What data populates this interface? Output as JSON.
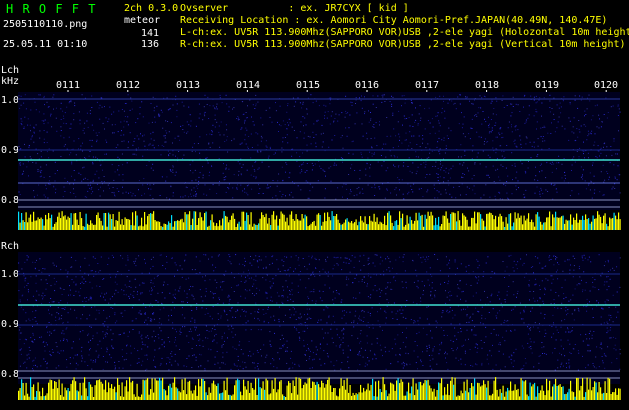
{
  "header": {
    "app_name": "H R O F F T",
    "version": "2ch 0.3.0",
    "file_name": "2505110110.png",
    "meteor_label": "meteor",
    "datetime": "25.05.11 01:10",
    "lch_count": "141",
    "rch_count": "136",
    "observer": "Ovserver          : ex. JR7CYX [ kid ]",
    "location": "Receiving Location : ex. Aomori City Aomori-Pref.JAPAN(40.49N, 140.47E)",
    "lch_info": "L-ch:ex. UV5R 113.900Mhz(SAPPORO VOR)USB ,2-ele yagi (Holozontal 10m height)",
    "rch_info": "R-ch:ex. UV5R 113.900Mhz(SAPPORO VOR)USB ,2-ele yagi (Vertical 10m height)"
  },
  "time_ticks": [
    "0111",
    "0112",
    "0113",
    "0114",
    "0115",
    "0116",
    "0117",
    "0118",
    "0119",
    "0120"
  ],
  "lch_panel": {
    "label": "Lch",
    "unit": "kHz",
    "y_ticks": [
      "1.0",
      "0.9",
      "0.8"
    ]
  },
  "rch_panel": {
    "label": "Rch",
    "y_ticks": [
      "1.0",
      "0.9",
      "0.8"
    ]
  },
  "colors": {
    "background": "#000000",
    "text_yellow": "#ffff00",
    "text_green": "#00ff00",
    "noise_blue": "#1a1a9a",
    "carrier": "#40e0d0",
    "spectrum_yellow": "#ffff00",
    "spectrum_cyan": "#00e0ff"
  }
}
